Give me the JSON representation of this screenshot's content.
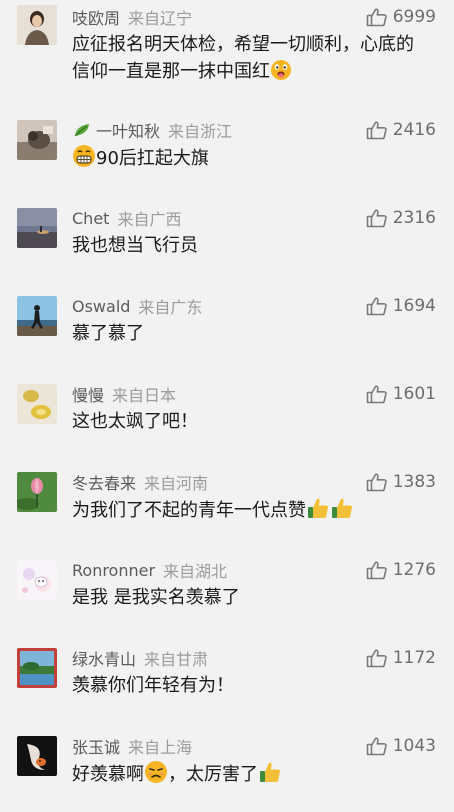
{
  "comments": [
    {
      "username": "吱欧周",
      "location": "来自辽宁",
      "likes": "6999",
      "text_parts": [
        "应征报名明天体检，希望一切顺利，心底的信仰一直是那一抹中国红"
      ],
      "avatar_icon": "person-portrait"
    },
    {
      "username": "一叶知秋",
      "location": "来自浙江",
      "likes": "2416",
      "text_parts": [
        "90后扛起大旗"
      ],
      "avatar_icon": "cat-photo",
      "name_icon": "leaf-icon"
    },
    {
      "username": "Chet",
      "location": "来自广西",
      "likes": "2316",
      "text_parts": [
        "我也想当飞行员"
      ],
      "avatar_icon": "dusk-landscape"
    },
    {
      "username": "Oswald",
      "location": "来自广东",
      "likes": "1694",
      "text_parts": [
        "慕了慕了"
      ],
      "avatar_icon": "person-silhouette-sky"
    },
    {
      "username": "慢慢",
      "location": "来自日本",
      "likes": "1601",
      "text_parts": [
        "这也太飒了吧！"
      ],
      "avatar_icon": "lemon-photo"
    },
    {
      "username": "冬去春来",
      "location": "来自河南",
      "likes": "1383",
      "text_parts": [
        "为我们了不起的青年一代点赞"
      ],
      "avatar_icon": "lotus-bud"
    },
    {
      "username": "Ronronner",
      "location": "来自湖北",
      "likes": "1276",
      "text_parts": [
        "是我 是我实名羡慕了"
      ],
      "avatar_icon": "cartoon-bunny"
    },
    {
      "username": "绿水青山",
      "location": "来自甘肃",
      "likes": "1172",
      "text_parts": [
        "羡慕你们年轻有为！"
      ],
      "avatar_icon": "river-landscape"
    },
    {
      "username": "张玉诚",
      "location": "来自上海",
      "likes": "1043",
      "text_parts": [
        "好羡慕啊",
        "，太厉害了"
      ],
      "avatar_icon": "goldfish-dark"
    }
  ],
  "colors": {
    "background": "#f2f2f2",
    "username": "#5b5b5b",
    "location": "#9c9c9c",
    "text": "#1a1a1a",
    "like_icon": "#7a7a7a"
  }
}
